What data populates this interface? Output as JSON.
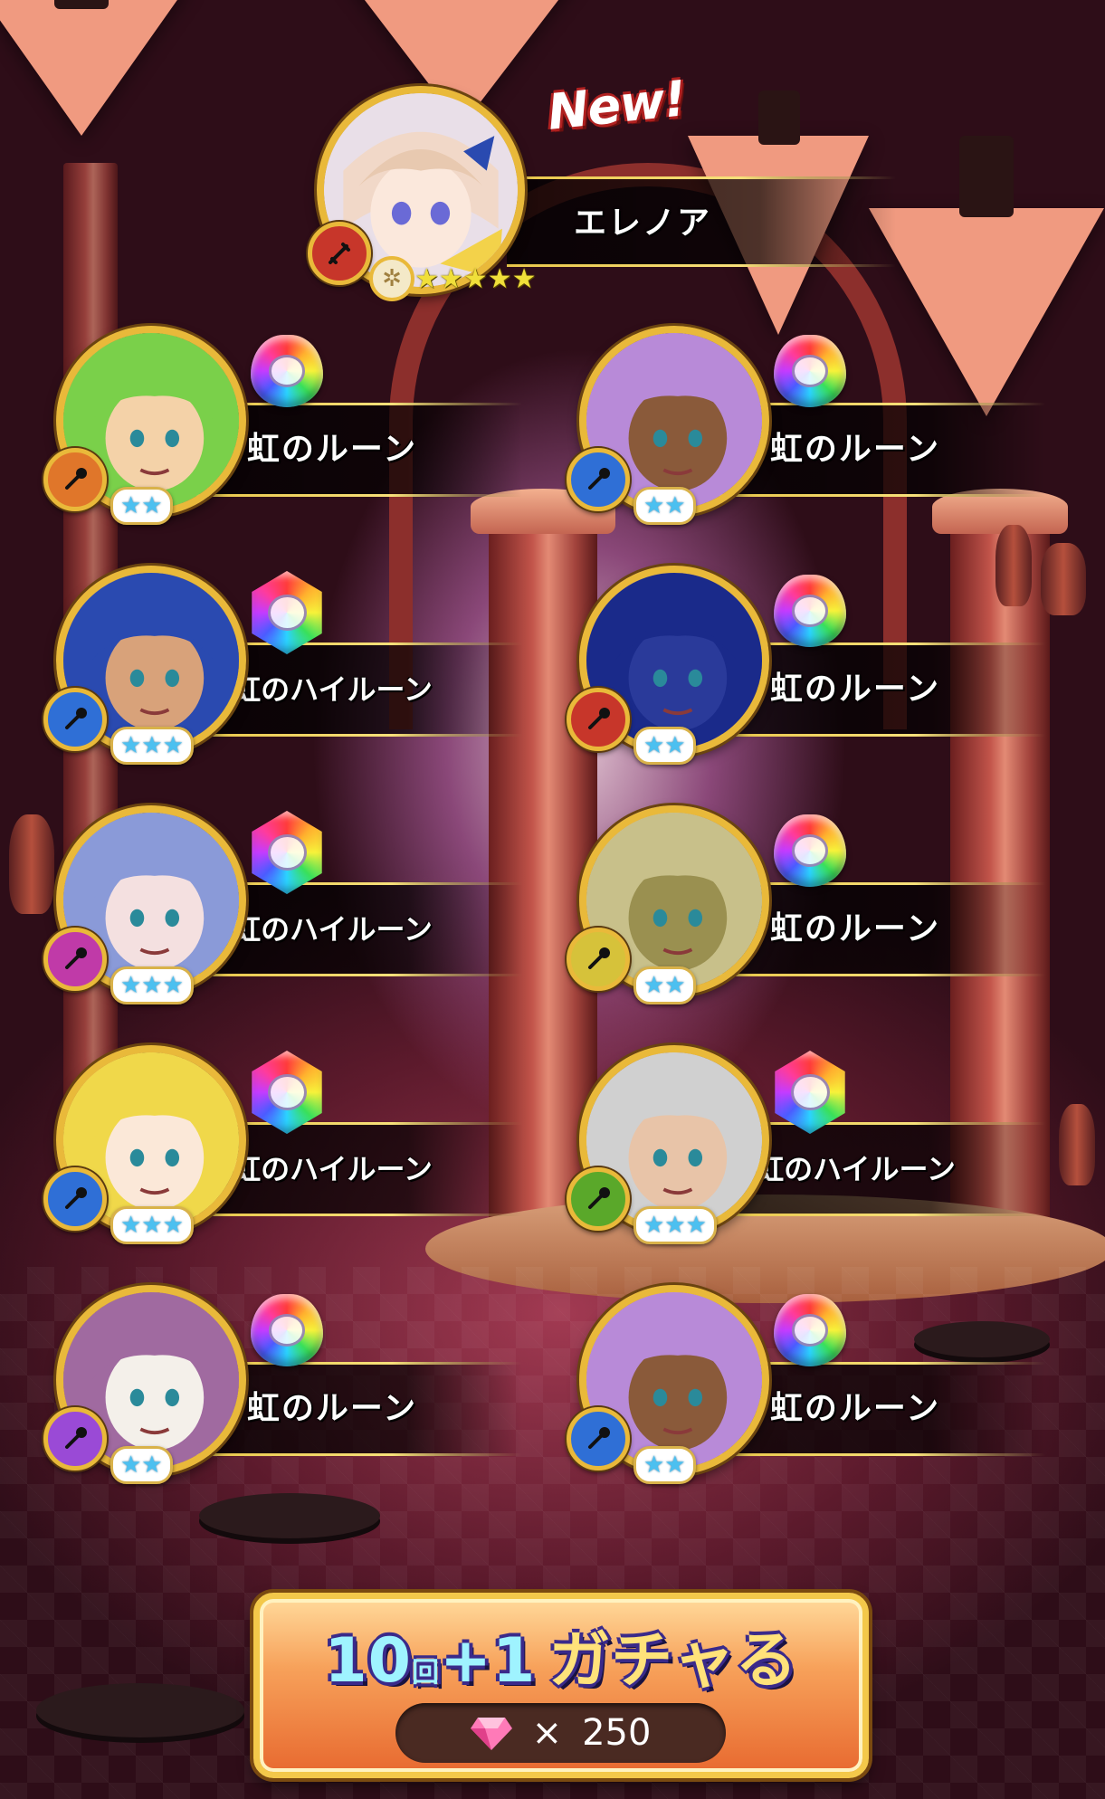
{
  "featured": {
    "new_badge": "New!",
    "name": "エレノア",
    "rarity_stars": 5,
    "stars_text": "★★★★★"
  },
  "results": [
    {
      "reward": "虹のルーン",
      "rune_type": "rune",
      "stars_text": "★★",
      "class_icon": "bow-icon",
      "class_color": "#e0762a"
    },
    {
      "reward": "虹のルーン",
      "rune_type": "rune",
      "stars_text": "★★",
      "class_icon": "axe-icon",
      "class_color": "#2f6fd6"
    },
    {
      "reward": "虹のハイルーン",
      "rune_type": "high-rune",
      "stars_text": "★★★",
      "class_icon": "axe-icon",
      "class_color": "#2f6fd6"
    },
    {
      "reward": "虹のルーン",
      "rune_type": "rune",
      "stars_text": "★★",
      "class_icon": "sword-icon",
      "class_color": "#c7362a"
    },
    {
      "reward": "虹のハイルーン",
      "rune_type": "high-rune",
      "stars_text": "★★★",
      "class_icon": "fist-icon",
      "class_color": "#c03aa8"
    },
    {
      "reward": "虹のルーン",
      "rune_type": "rune",
      "stars_text": "★★",
      "class_icon": "fist-icon",
      "class_color": "#d6c23a"
    },
    {
      "reward": "虹のハイルーン",
      "rune_type": "high-rune",
      "stars_text": "★★★",
      "class_icon": "axe-icon",
      "class_color": "#2f6fd6"
    },
    {
      "reward": "虹のハイルーン",
      "rune_type": "high-rune",
      "stars_text": "★★★",
      "class_icon": "leaf-icon",
      "class_color": "#5aa82a"
    },
    {
      "reward": "虹のルーン",
      "rune_type": "rune",
      "stars_text": "★★",
      "class_icon": "staff-icon",
      "class_color": "#9a4ad6"
    },
    {
      "reward": "虹のルーン",
      "rune_type": "rune",
      "stars_text": "★★",
      "class_icon": "axe-icon",
      "class_color": "#2f6fd6"
    }
  ],
  "gacha_button": {
    "count": "10",
    "kai": "回",
    "plus": "+1",
    "label": "ガチャる",
    "cost_symbol": "×",
    "cost": "250"
  }
}
